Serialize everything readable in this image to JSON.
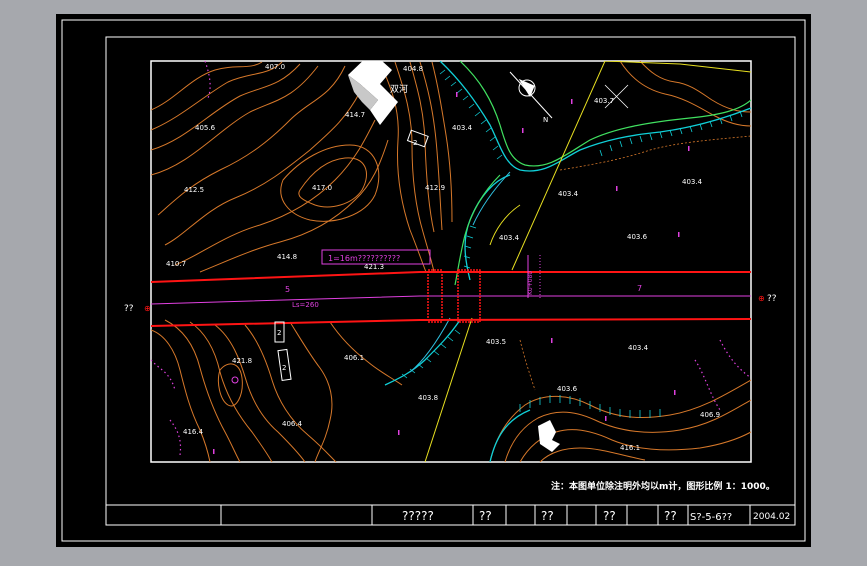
{
  "drawing": {
    "background_color": "#000000",
    "viewport_color": "#a6a8ad",
    "river_label": "双河",
    "note": "注：本图单位除注明外均以m计，图形比例 1：1000。",
    "left_marker": "??",
    "right_marker": "??",
    "curve_label_1": "1=16m??????????",
    "curve_label_2": "Ls=260",
    "curve_label_3": "7",
    "curve_label_4": "5",
    "vertical_label": "K0+080",
    "boxes": [
      "2",
      "2",
      "2"
    ],
    "elevations": [
      {
        "t": "407.0"
      },
      {
        "t": "404.8"
      },
      {
        "t": "403.7"
      },
      {
        "t": "405.6"
      },
      {
        "t": "414.7"
      },
      {
        "t": "403.4"
      },
      {
        "t": "412.5"
      },
      {
        "t": "417.0"
      },
      {
        "t": "412.9"
      },
      {
        "t": "403.4"
      },
      {
        "t": "403.4"
      },
      {
        "t": "403.6"
      },
      {
        "t": "403.4"
      },
      {
        "t": "414.8"
      },
      {
        "t": "421.3"
      },
      {
        "t": "410.7"
      },
      {
        "t": "403.5"
      },
      {
        "t": "403.4"
      },
      {
        "t": "421.8"
      },
      {
        "t": "406.1"
      },
      {
        "t": "403.6"
      },
      {
        "t": "403.8"
      },
      {
        "t": "406.9"
      },
      {
        "t": "416.4"
      },
      {
        "t": "406.4"
      },
      {
        "t": "416.1"
      }
    ]
  },
  "title_block": {
    "cells": [
      "?????",
      "??",
      "??",
      "??",
      "??",
      "S?-5-6??",
      "2004.02"
    ]
  },
  "colors": {
    "contour_orange": "#d6782a",
    "contour_brown": "#b8682a",
    "road_red": "#ff1414",
    "centerline_magenta": "#e040e0",
    "river_cyan": "#10d0d8",
    "river_green": "#40e060",
    "yellow": "#e8e020"
  }
}
